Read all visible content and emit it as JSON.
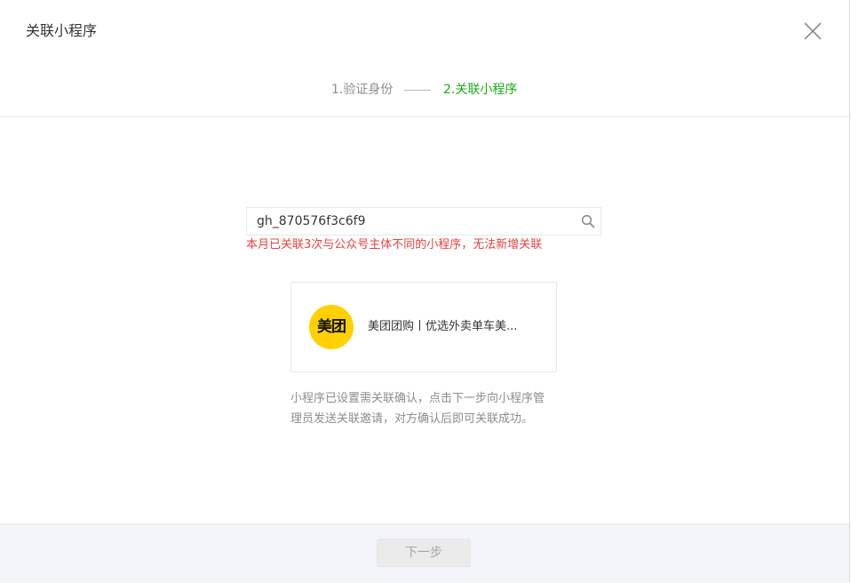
{
  "dialog": {
    "title": "关联小程序",
    "close_icon": "close-icon"
  },
  "steps": {
    "step1": "1.验证身份",
    "step2": "2.关联小程序",
    "active_color": "#1aad19",
    "inactive_color": "#8d8d8d"
  },
  "search": {
    "value": "gh_870576f3c6f9",
    "icon": "search-icon",
    "error": "本月已关联3次与公众号主体不同的小程序，无法新增关联",
    "error_color": "#e64340"
  },
  "app_card": {
    "logo_text": "美团",
    "logo_color": "#ffd100",
    "name": "美团团购丨优选外卖单车美..."
  },
  "tip": "小程序已设置需关联确认，点击下一步向小程序管理员发送关联邀请，对方确认后即可关联成功。",
  "footer": {
    "next_label": "下一步"
  }
}
